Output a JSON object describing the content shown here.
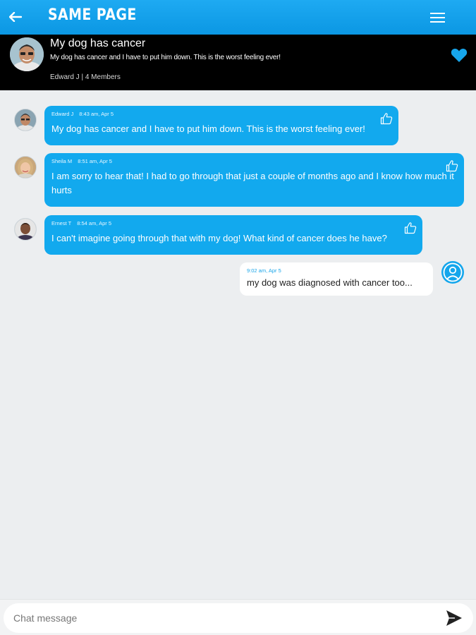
{
  "app": {
    "title": "SAME PAGE",
    "accent_color": "#12a9ee",
    "icons": {
      "back": "arrow-left-icon",
      "menu": "hamburger-menu-icon",
      "favorite": "heart-icon",
      "like": "thumbs-up-icon",
      "send": "send-icon"
    }
  },
  "thread": {
    "title": "My dog has cancer",
    "subtitle": "My dog has cancer and I have to put him down. This is the worst feeling ever!",
    "meta": "Edward J | 4 Members"
  },
  "messages": [
    {
      "author": "Edward J",
      "time": "8:43 am, Apr 5",
      "text": "My dog has cancer and I have to put him down. This is the worst feeling ever!"
    },
    {
      "author": "Sheila M",
      "time": "8:51 am, Apr 5",
      "text": "I am sorry to hear that! I had to go through that just a couple of months ago and I know how much it hurts"
    },
    {
      "author": "Ernest T",
      "time": "8:54 am, Apr 5",
      "text": "I can't imagine going through that with my dog! What kind of cancer does he have?"
    },
    {
      "time": "9:02 am, Apr 5",
      "text": "my dog was diagnosed with cancer too..."
    }
  ],
  "composer": {
    "placeholder": "Chat message"
  }
}
